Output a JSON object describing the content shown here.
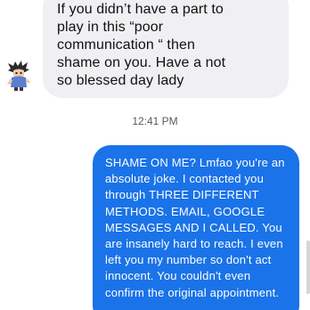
{
  "conversation": {
    "incoming_message": {
      "lines": [
        "If you didn’t have a part to",
        "play in this “poor",
        "communication “ then",
        "shame on you. Have a not",
        "so blessed day lady"
      ]
    },
    "timestamp": "12:41 PM",
    "outgoing_message": {
      "lines": [
        "SHAME ON ME? Lmfao you're  an",
        "absolute joke. I contacted you",
        "through THREE DIFFERENT",
        "METHODS. EMAIL, GOOGLE",
        "MESSAGES AND I CALLED. You",
        "are insanely hard to reach. I even",
        "left you my number so don't act",
        "innocent.  You couldn't even",
        "confirm the original appointment."
      ]
    }
  },
  "icons": {
    "avatar": "cartoon-avatar-icon"
  },
  "colors": {
    "incoming_bubble": "#f0f0f3",
    "outgoing_bubble": "#1a73e8",
    "timestamp_text": "#555a60"
  }
}
